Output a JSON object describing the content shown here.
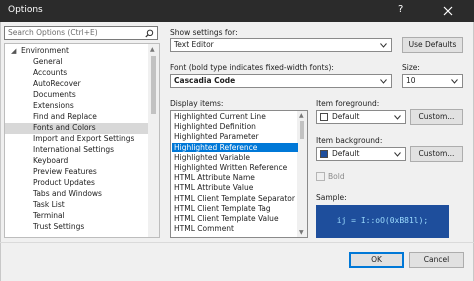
{
  "window": {
    "title": "Options",
    "help_glyph": "?",
    "close_icon": "close-icon"
  },
  "search": {
    "placeholder": "Search Options (Ctrl+E)",
    "icon": "search-icon"
  },
  "tree": {
    "items": [
      {
        "label": "Environment",
        "level": 0,
        "expanded": true
      },
      {
        "label": "General",
        "level": 1
      },
      {
        "label": "Accounts",
        "level": 1
      },
      {
        "label": "AutoRecover",
        "level": 1
      },
      {
        "label": "Documents",
        "level": 1
      },
      {
        "label": "Extensions",
        "level": 1
      },
      {
        "label": "Find and Replace",
        "level": 1
      },
      {
        "label": "Fonts and Colors",
        "level": 1,
        "selected": true
      },
      {
        "label": "Import and Export Settings",
        "level": 1
      },
      {
        "label": "International Settings",
        "level": 1
      },
      {
        "label": "Keyboard",
        "level": 1
      },
      {
        "label": "Preview Features",
        "level": 1
      },
      {
        "label": "Product Updates",
        "level": 1
      },
      {
        "label": "Tabs and Windows",
        "level": 1
      },
      {
        "label": "Task List",
        "level": 1
      },
      {
        "label": "Terminal",
        "level": 1
      },
      {
        "label": "Trust Settings",
        "level": 1
      }
    ]
  },
  "settings": {
    "show_settings_for_label": "Show settings for:",
    "show_settings_for_value": "Text Editor",
    "use_defaults_label": "Use Defaults",
    "font_label": "Font (bold type indicates fixed-width fonts):",
    "font_value": "Cascadia Code",
    "size_label": "Size:",
    "size_value": "10"
  },
  "display_items": {
    "label": "Display items:",
    "items": [
      "Highlighted Current Line",
      "Highlighted Definition",
      "Highlighted Parameter",
      "Highlighted Reference",
      "Highlighted Variable",
      "Highlighted Written Reference",
      "HTML Attribute Name",
      "HTML Attribute Value",
      "HTML Client Template Separator",
      "HTML Client Template Tag",
      "HTML Client Template Value",
      "HTML Comment"
    ],
    "selected_index": 3
  },
  "item_foreground": {
    "label": "Item foreground:",
    "value": "Default",
    "swatch_color": "#ffffff",
    "custom_label": "Custom..."
  },
  "item_background": {
    "label": "Item background:",
    "value": "Default",
    "swatch_color": "#1e4e9c",
    "custom_label": "Custom..."
  },
  "bold": {
    "label": "Bold",
    "checked": false
  },
  "sample": {
    "label": "Sample:",
    "text": "ij = I::oO(0xB81l);",
    "background": "#1e4e9c",
    "foreground": "#9cdcfe"
  },
  "footer": {
    "ok_label": "OK",
    "cancel_label": "Cancel"
  },
  "colors": {
    "accent": "#0078d7",
    "titlebar": "#2b2b2b"
  }
}
